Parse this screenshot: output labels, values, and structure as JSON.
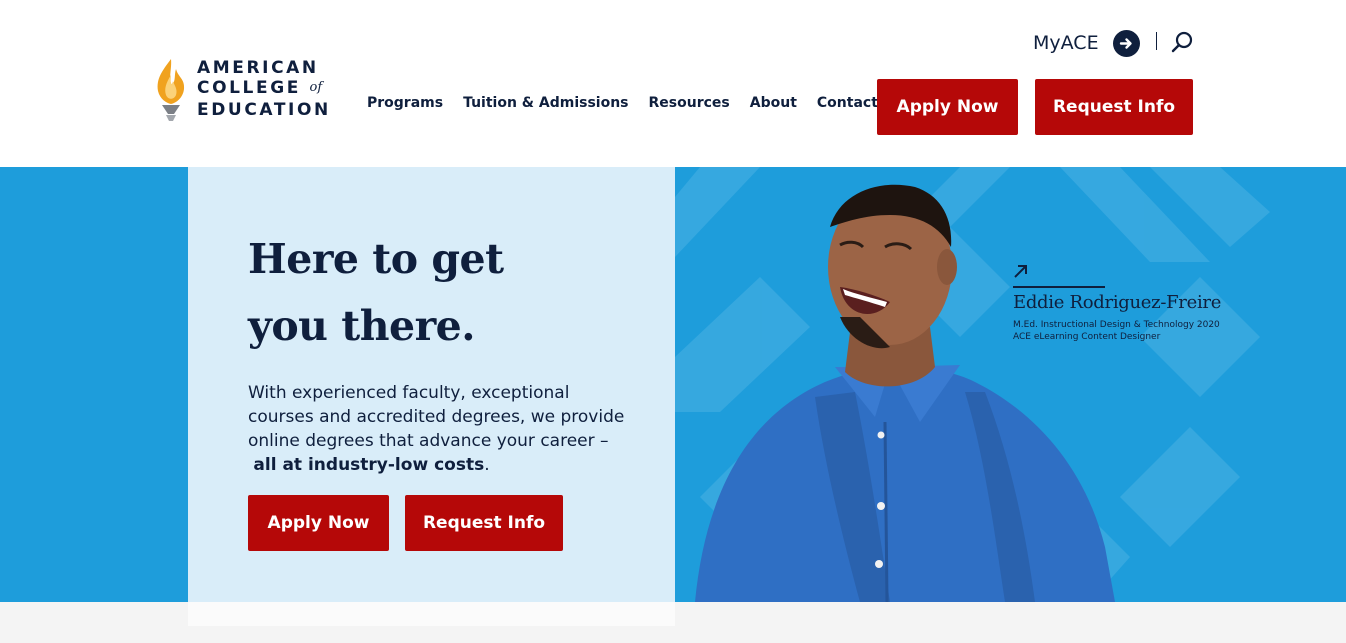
{
  "brand": {
    "line1": "AMERICAN",
    "line2": "COLLEGE",
    "of": "of",
    "line3": "EDUCATION",
    "accent": "#b50808",
    "navy": "#0f1f3d",
    "hero_blue": "#1e9ddb",
    "card_blue": "#d9edf9"
  },
  "nav": {
    "items": [
      {
        "label": "Programs"
      },
      {
        "label": "Tuition & Admissions"
      },
      {
        "label": "Resources"
      },
      {
        "label": "About"
      },
      {
        "label": "Contact"
      }
    ]
  },
  "utility": {
    "myace_label": "MyACE",
    "myace_icon": "arrow-right-circle-icon",
    "search_icon": "search-icon"
  },
  "header_cta": {
    "apply_label": "Apply Now",
    "info_label": "Request Info"
  },
  "hero": {
    "headline_line1": "Here to get",
    "headline_line2": "you there.",
    "body_text": "With experienced faculty, exceptional courses and accredited degrees, we provide online degrees that advance your career –",
    "body_bold": "all at industry-low costs",
    "body_end": ".",
    "apply_label": "Apply Now",
    "info_label": "Request Info"
  },
  "testimonial": {
    "name": "Eddie Rodriguez-Freire",
    "degree": "M.Ed. Instructional Design & Technology 2020",
    "role": "ACE eLearning Content Designer",
    "arrow_icon": "arrow-up-right-icon"
  }
}
